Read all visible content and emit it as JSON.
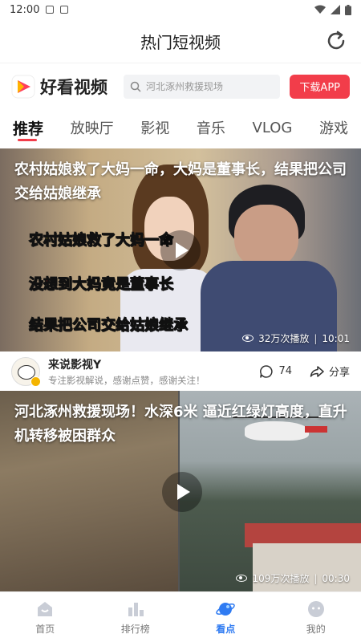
{
  "status_bar": {
    "time": "12:00"
  },
  "header": {
    "title": "热门短视频"
  },
  "brand": {
    "name": "好看视频",
    "search_placeholder": "河北涿州救援现场",
    "download_label": "下载APP"
  },
  "tabs": [
    "推荐",
    "放映厅",
    "影视",
    "音乐",
    "VLOG",
    "游戏"
  ],
  "videos": [
    {
      "title": "农村姑娘救了大妈一命，大妈是董事长，结果把公司交给姑娘继承",
      "captions": [
        "农村姑娘救了大妈一命",
        "没想到大妈竟是董事长",
        "结果把公司交给姑娘继承"
      ],
      "views": "32万次播放",
      "duration": "10:01",
      "author": {
        "name": "来说影视Y",
        "desc": "专注影视解说，感谢点赞，感谢关注！"
      },
      "comments": "74",
      "share_label": "分享"
    },
    {
      "title": "河北涿州救援现场！水深6米 逼近红绿灯高度，直升机转移被困群众",
      "views": "109万次播放",
      "duration": "00:30"
    }
  ],
  "bottom_nav": [
    "首页",
    "排行榜",
    "看点",
    "我的"
  ],
  "colors": {
    "accent_red": "#f23d4a",
    "nav_active": "#2f7bf2"
  }
}
